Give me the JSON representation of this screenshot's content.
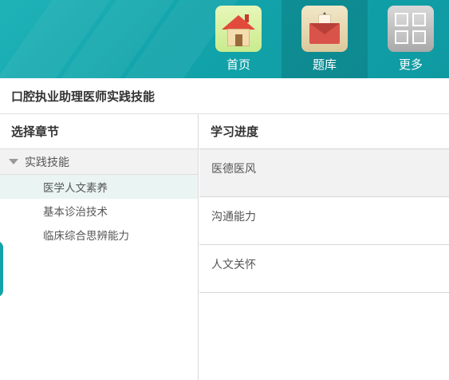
{
  "nav": {
    "items": [
      {
        "label": "首页",
        "icon": "home-icon"
      },
      {
        "label": "题库",
        "icon": "question-bank-icon"
      },
      {
        "label": "更多",
        "icon": "more-grid-icon"
      }
    ],
    "active_index": 1
  },
  "title": "口腔执业助理医师实践技能",
  "left": {
    "header": "选择章节",
    "chapter": "实践技能",
    "sections": [
      "医学人文素养",
      "基本诊治技术",
      "临床综合思辨能力"
    ],
    "selected_section_index": 0
  },
  "right": {
    "header": "学习进度",
    "items": [
      "医德医风",
      "沟通能力",
      "人文关怀"
    ]
  },
  "colors": {
    "header_bg": "#12a4ab",
    "selected_section_bg": "#eaf4f3",
    "row_highlight_bg": "#f2f2f2"
  }
}
